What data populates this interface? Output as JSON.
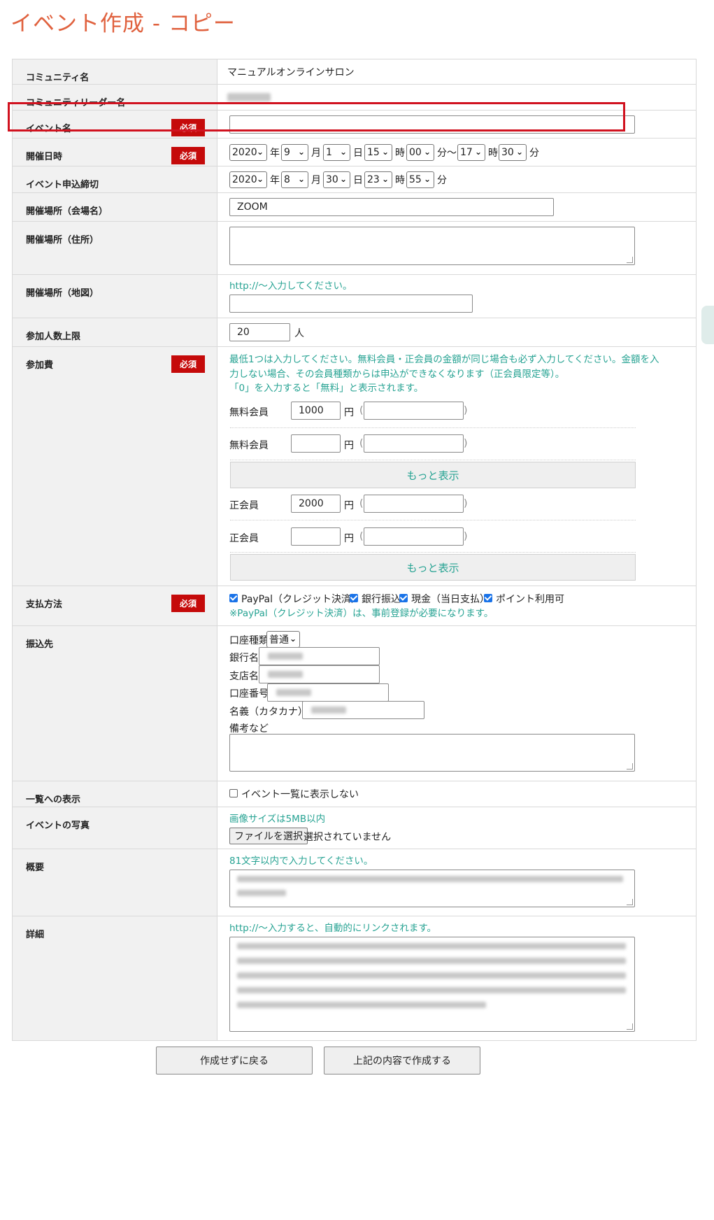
{
  "page_title": "イベント作成 - コピー",
  "required_label": "必須",
  "rows": {
    "community": {
      "label": "コミュニティ名",
      "value": "マニュアルオンラインサロン"
    },
    "leader": {
      "label": "コミュニティリーダー名"
    },
    "event_name": {
      "label": "イベント名",
      "value": ""
    },
    "datetime": {
      "label": "開催日時",
      "year": "2020",
      "month": "9",
      "day": "1",
      "hour": "15",
      "minute": "00",
      "end_hour": "17",
      "end_minute": "30",
      "u_year": "年",
      "u_month": "月",
      "u_day": "日",
      "u_hour": "時",
      "u_minute_tilde": "分〜",
      "u_minute": "分"
    },
    "deadline": {
      "label": "イベント申込締切",
      "year": "2020",
      "month": "8",
      "day": "30",
      "hour": "23",
      "minute": "55"
    },
    "venue_name": {
      "label": "開催場所（会場名）",
      "value": "ZOOM"
    },
    "venue_address": {
      "label": "開催場所（住所）"
    },
    "venue_map": {
      "label": "開催場所（地図）",
      "hint": "http://〜入力してください。",
      "value": ""
    },
    "capacity": {
      "label": "参加人数上限",
      "value": "20",
      "unit": "人"
    },
    "fee": {
      "label": "参加費",
      "hint_line1": "最低1つは入力してください。無料会員・正会員の金額が同じ場合も必ず入力してください。金額を入",
      "hint_line2": "力しない場合、その会員種類からは申込ができなくなります（正会員限定等）。",
      "hint_line3": "「0」を入力すると「無料」と表示されます。",
      "yen": "円",
      "paren_open": "(",
      "paren_close": ")",
      "more_label": "もっと表示",
      "entries": [
        {
          "member": "無料会員",
          "amount": "1000"
        },
        {
          "member": "無料会員",
          "amount": ""
        },
        {
          "member": "正会員",
          "amount": "2000"
        },
        {
          "member": "正会員",
          "amount": ""
        }
      ]
    },
    "payment": {
      "label": "支払方法",
      "options": [
        {
          "label": "PayPal（クレジット決済）",
          "checked": true
        },
        {
          "label": "銀行振込",
          "checked": true
        },
        {
          "label": "現金（当日支払）",
          "checked": true
        },
        {
          "label": "ポイント利用可",
          "checked": true
        }
      ],
      "note": "※PayPal（クレジット決済）は、事前登録が必要になります。"
    },
    "bank": {
      "label": "振込先",
      "account_type_label": "口座種類",
      "account_type_value": "普通",
      "bank_name_label": "銀行名",
      "branch_label": "支店名",
      "account_no_label": "口座番号",
      "holder_label": "名義（カタカナ）",
      "notes_label": "備考など"
    },
    "listing": {
      "label": "一覧への表示",
      "option": "イベント一覧に表示しない",
      "checked": false
    },
    "photo": {
      "label": "イベントの写真",
      "hint": "画像サイズは5MB以内",
      "button": "ファイルを選択",
      "status": "選択されていません"
    },
    "summary": {
      "label": "概要",
      "hint": "81文字以内で入力してください。"
    },
    "detail": {
      "label": "詳細",
      "hint": "http://〜入力すると、自動的にリンクされます。"
    }
  },
  "buttons": {
    "back": "作成せずに戻る",
    "create": "上記の内容で作成する"
  }
}
